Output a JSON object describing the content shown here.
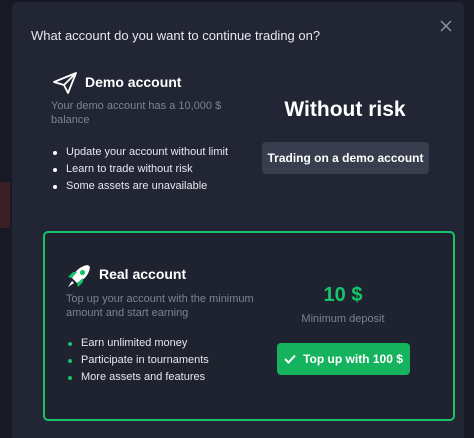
{
  "dialog": {
    "title": "What account do you want to continue trading on?",
    "close_icon": "close-icon"
  },
  "demo_account": {
    "icon": "paper-plane-icon",
    "title": "Demo account",
    "description": "Your demo account has a 10,000 $ balance",
    "features": [
      "Update your account without limit",
      "Learn to trade without risk",
      "Some assets are unavailable"
    ],
    "headline": "Without risk",
    "button_label": "Trading on a demo account"
  },
  "real_account": {
    "icon": "rocket-icon",
    "title": "Real account",
    "description": "Top up your account with the minimum amount and start earning",
    "features": [
      "Earn unlimited money",
      "Participate in tournaments",
      "More assets and features"
    ],
    "min_deposit_amount": "10 $",
    "min_deposit_label": "Minimum deposit",
    "button_icon": "check-icon",
    "button_label": "Top up with 100 $"
  },
  "colors": {
    "background": "#222634",
    "accent_green": "#16c46a",
    "button_gray": "#393e4e",
    "muted_text": "#7c8296"
  }
}
